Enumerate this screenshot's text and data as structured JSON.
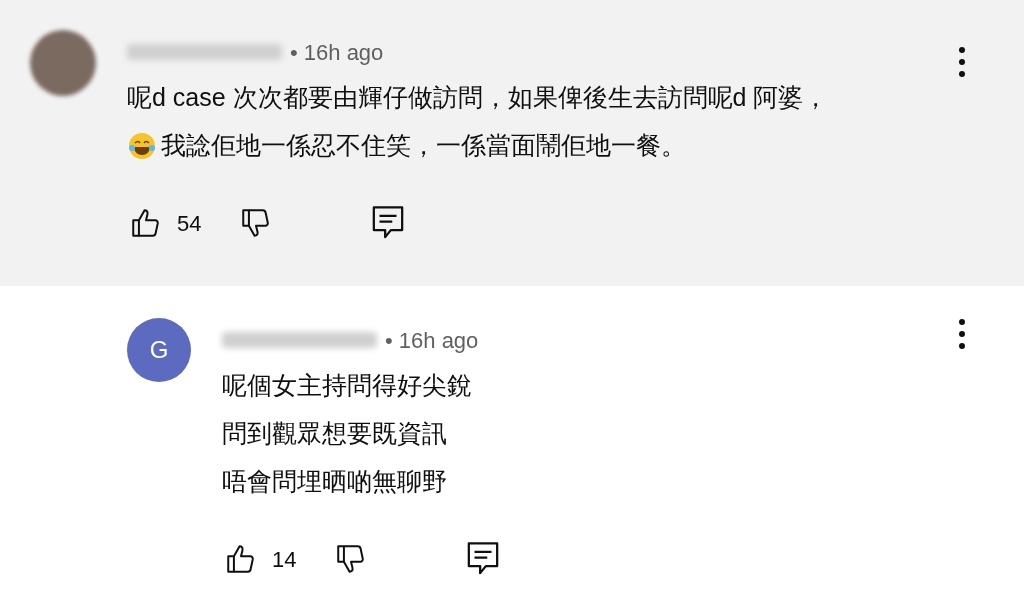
{
  "comments": [
    {
      "highlighted": true,
      "avatar": {
        "kind": "photo"
      },
      "time": "• 16h ago",
      "lines": [
        {
          "text": "呢d case 次次都要由輝仔做訪問，如果俾後生去訪問呢d 阿婆，",
          "emoji": false
        },
        {
          "text": "我諗佢地一係忍不住笑，一係當面鬧佢地一餐。",
          "emoji": true
        }
      ],
      "likes": "54"
    },
    {
      "highlighted": false,
      "avatar": {
        "kind": "letter",
        "letter": "G"
      },
      "time": "• 16h ago",
      "lines": [
        {
          "text": "呢個女主持問得好尖銳",
          "emoji": false
        },
        {
          "text": "問到觀眾想要既資訊",
          "emoji": false
        },
        {
          "text": "唔會問埋晒啲無聊野",
          "emoji": false
        }
      ],
      "likes": "14"
    }
  ]
}
